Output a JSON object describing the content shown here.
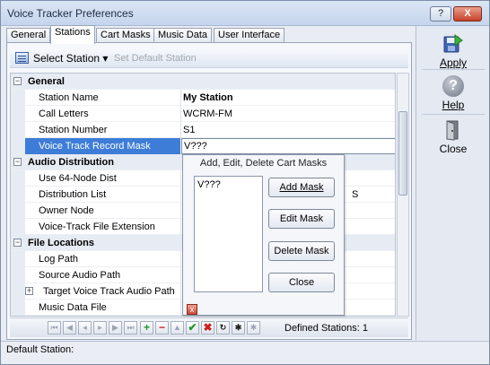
{
  "window": {
    "title": "Voice Tracker Preferences",
    "help_glyph": "?",
    "close_glyph": "X"
  },
  "tabs": [
    {
      "label": "General"
    },
    {
      "label": "Stations",
      "active": true
    },
    {
      "label": "Cart Masks"
    },
    {
      "label": "Music Data"
    },
    {
      "label": "User Interface"
    }
  ],
  "toolbar": {
    "select_station": "Select Station ▾",
    "set_default": "Set Default Station"
  },
  "grid": {
    "general_header": "General",
    "station_name": {
      "label": "Station Name",
      "value": "My Station"
    },
    "call_letters": {
      "label": "Call Letters",
      "value": "WCRM-FM"
    },
    "station_number": {
      "label": "Station Number",
      "value": "S1"
    },
    "voice_track_mask": {
      "label": "Voice Track Record Mask",
      "value": "V???"
    },
    "audio_header": "Audio Distribution",
    "use_64_node": {
      "label": "Use 64-Node Dist"
    },
    "distribution_list": {
      "label": "Distribution List",
      "partial_value": "S"
    },
    "owner_node": {
      "label": "Owner Node"
    },
    "vt_file_ext": {
      "label": "Voice-Track File Extension"
    },
    "files_header": "File Locations",
    "log_path": {
      "label": "Log Path"
    },
    "source_audio_path": {
      "label": "Source Audio Path"
    },
    "target_vt_path": {
      "label": "Target Voice Track Audio Path"
    },
    "music_data_file": {
      "label": "Music Data File"
    },
    "collapse_glyph": "−",
    "expand_glyph": "+"
  },
  "popup": {
    "title": "Add, Edit, Delete Cart Masks",
    "masks": [
      "V???"
    ],
    "add_label": "Add Mask",
    "edit_label": "Edit Mask",
    "delete_label": "Delete Mask",
    "close_label": "Close",
    "close_glyph": "x"
  },
  "navigator": {
    "first": "⏮",
    "prev_page": "◀",
    "prev": "◂",
    "next": "▸",
    "next_page": "▶",
    "last": "⏭",
    "add": "+",
    "delete": "−",
    "edit": "▲",
    "post": "✔",
    "cancel": "✖",
    "refresh": "↻",
    "bookmark": "✱",
    "goto": "✱",
    "defined_stations": "Defined Stations: 1"
  },
  "actions": {
    "apply": "Apply",
    "help": "Help",
    "close": "Close",
    "help_glyph": "?"
  },
  "status": {
    "text": "Default Station:"
  },
  "colors": {
    "selection": "#3d7dd8",
    "accent": "#3c62a8"
  }
}
